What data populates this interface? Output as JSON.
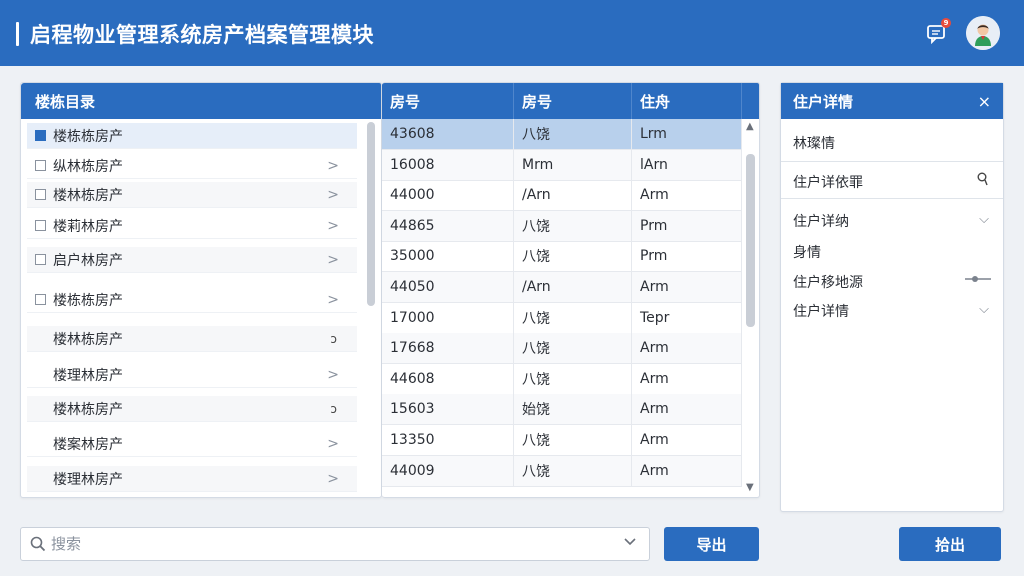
{
  "app": {
    "title": "启程物业管理系统房产档案管理模块",
    "notification_count": "9"
  },
  "tree": {
    "header": "楼栋目录",
    "items": [
      {
        "label": "楼栋栋房产",
        "checked": true,
        "right": ""
      },
      {
        "label": "纵林栋房产",
        "checked": false,
        "right": ">"
      },
      {
        "label": "楼林栋房产",
        "checked": false,
        "right": ">"
      },
      {
        "label": "楼莉林房产",
        "checked": false,
        "right": ">"
      },
      {
        "label": "启户林房产",
        "checked": false,
        "right": ">"
      },
      {
        "label": "楼栋栋房产",
        "checked": false,
        "right": ">"
      },
      {
        "label": "楼林栋房产",
        "checked": null,
        "right": "ↄ"
      },
      {
        "label": "楼理林房产",
        "checked": null,
        "right": ">"
      },
      {
        "label": "楼林栋房产",
        "checked": null,
        "right": "ↄ"
      },
      {
        "label": "楼案林房产",
        "checked": null,
        "right": ">"
      },
      {
        "label": "楼理林房产",
        "checked": null,
        "right": ">"
      }
    ]
  },
  "table": {
    "columns": [
      "房号",
      "房号",
      "住舟"
    ],
    "rows": [
      [
        "43608",
        "八饶",
        "Lrm"
      ],
      [
        "16008",
        "Mrm",
        "lArn"
      ],
      [
        "44000",
        "/Arn",
        "Arm"
      ],
      [
        "44865",
        "八饶",
        "Prm"
      ],
      [
        "35000",
        "八饶",
        "Prm"
      ],
      [
        "44050",
        "/Arn",
        "Arm"
      ],
      [
        "17000",
        "八饶",
        "Tepr"
      ],
      [
        "17668",
        "八饶",
        "Arm"
      ],
      [
        "44608",
        "八饶",
        "Arm"
      ],
      [
        "15603",
        "始饶",
        "Arm"
      ],
      [
        "13350",
        "八饶",
        "Arm"
      ],
      [
        "44009",
        "八饶",
        "Arm"
      ]
    ]
  },
  "detail": {
    "header": "住户详情",
    "close_icon": "×",
    "line1": "林璨情",
    "field_label": "住户详依罪",
    "field_icon": "search-icon",
    "items": [
      {
        "label": "住户详纳",
        "control": "chevron-down"
      },
      {
        "label": "身情",
        "control": ""
      },
      {
        "label": "住户移地源",
        "control": "slider"
      },
      {
        "label": "住户详情",
        "control": "chevron-down"
      }
    ]
  },
  "bottom": {
    "search_placeholder": "搜索",
    "export_label": "导出",
    "detail_label": "拾出"
  },
  "colors": {
    "primary": "#2a6cbf",
    "selected_row": "#b8d0ec",
    "background": "#eef1f5"
  }
}
